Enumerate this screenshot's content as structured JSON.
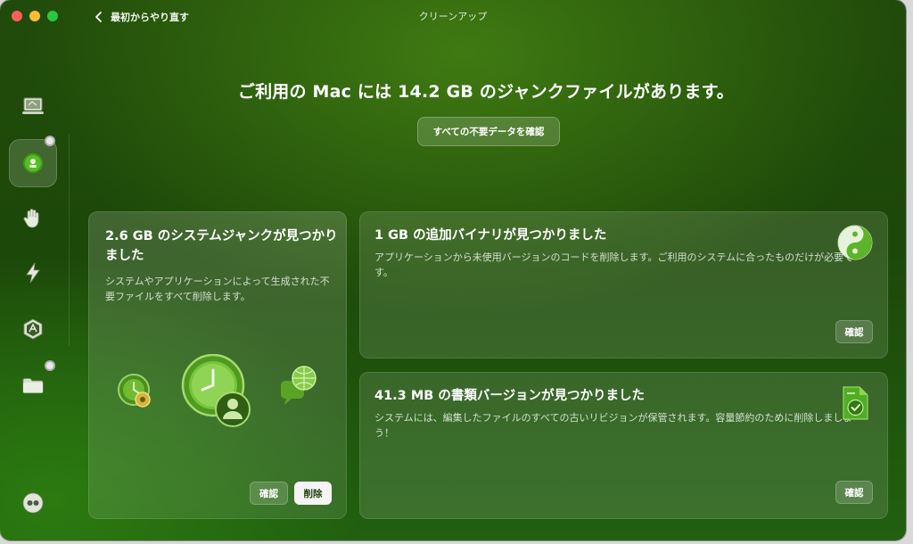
{
  "window": {
    "title": "クリーンアップ",
    "back_label": "最初からやり直す"
  },
  "headline": "ご利用の Mac には 14.2 GB のジャンクファイルがあります。",
  "review_all_label": "すべての不要データを確認",
  "sidebar": {
    "items": [
      {
        "icon": "monitor-icon"
      },
      {
        "icon": "cleanup-icon",
        "active": true
      },
      {
        "icon": "hand-icon"
      },
      {
        "icon": "lightning-icon"
      },
      {
        "icon": "apps-icon"
      },
      {
        "icon": "folder-icon"
      },
      {
        "icon": "assistant-icon"
      }
    ]
  },
  "cards": {
    "system_junk": {
      "title": "2.6 GB のシステムジャンクが見つかりました",
      "description": "システムやアプリケーションによって生成された不要ファイルをすべて削除します。",
      "review_label": "確認",
      "delete_label": "削除"
    },
    "universal_binaries": {
      "title": "1 GB の追加バイナリが見つかりました",
      "description": "アプリケーションから未使用バージョンのコードを削除します。ご利用のシステムに合ったものだけが必要です。",
      "review_label": "確認"
    },
    "document_versions": {
      "title": "41.3 MB の書類バージョンが見つかりました",
      "description": "システムには、編集したファイルのすべての古いリビジョンが保管されます。容量節約のために削除しましょう！",
      "review_label": "確認"
    }
  },
  "colors": {
    "accent_green": "#4caf1e",
    "background_top": "#214b0a",
    "background_bottom": "#216010"
  }
}
